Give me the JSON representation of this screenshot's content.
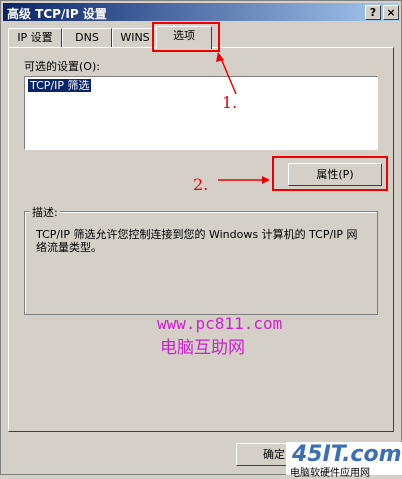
{
  "window": {
    "title": "高级 TCP/IP 设置",
    "help_label": "?",
    "close_label": "×"
  },
  "tabs": [
    {
      "label": "IP 设置"
    },
    {
      "label": "DNS"
    },
    {
      "label": "WINS"
    },
    {
      "label": "选项"
    }
  ],
  "options": {
    "available_label": "可选的设置(O):",
    "list_items": [
      "TCP/IP 筛选"
    ],
    "properties_label": "属性(P)"
  },
  "description": {
    "title": "描述:",
    "text": "TCP/IP 筛选允许您控制连接到您的 Windows 计算机的 TCP/IP 网络流量类型。"
  },
  "buttons": {
    "ok_label": "确定"
  },
  "annotations": {
    "step1": "1.",
    "step2": "2."
  },
  "watermark": {
    "url": "www.pc811.com",
    "name": "电脑互助网"
  },
  "logo": {
    "main": "45IT.com",
    "sub": "电脑软硬件应用网"
  },
  "colors": {
    "annotation_red": "#e00000",
    "title_bar": "#0a246a",
    "selection": "#0a246a",
    "watermark": "#d020d0"
  }
}
